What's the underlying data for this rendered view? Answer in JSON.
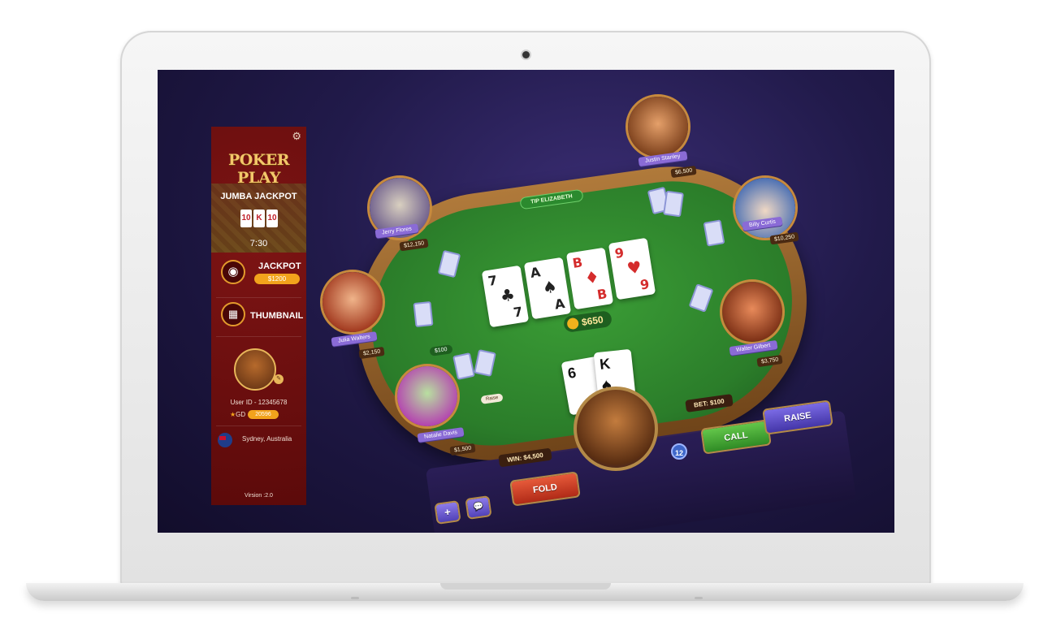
{
  "sidebar": {
    "logo": "POKER PLAY",
    "jumba_title": "JUMBA JACKPOT",
    "jumba_cards": [
      "10",
      "K",
      "10"
    ],
    "jumba_time": "7:30",
    "jackpot_label": "JACKPOT",
    "jackpot_value": "$1200",
    "thumbnail_label": "THUMBNAIL",
    "user_id": "User ID - 12345678",
    "gd_label": "GD",
    "gd_value": "20596",
    "location": "Sydney, Australia",
    "version": "Virsion :2.0"
  },
  "table": {
    "dealer_tag": "TIP ELIZABETH",
    "community_cards": [
      {
        "rank": "7",
        "suit": "♣",
        "color": "black"
      },
      {
        "rank": "A",
        "suit": "♠",
        "color": "black"
      },
      {
        "rank": "B",
        "suit": "♦",
        "color": "red"
      },
      {
        "rank": "9",
        "suit": "♥",
        "color": "red"
      }
    ],
    "pot": "$650",
    "bet_chip": "$100",
    "hole_cards": [
      "6",
      "K"
    ]
  },
  "players": {
    "jerry": {
      "name": "Jerry Flores",
      "stack": "$12,150"
    },
    "justin": {
      "name": "Justin Stanley",
      "stack": "$6,500"
    },
    "billy": {
      "name": "Billy Curtis",
      "stack": "$10,250"
    },
    "julia": {
      "name": "Julia Walters",
      "stack": "$2,150"
    },
    "walter": {
      "name": "Walter Gilbert",
      "stack": "$3,750"
    },
    "natalie": {
      "name": "Natalie Davis",
      "stack": "$1,500",
      "action": "Raise"
    }
  },
  "hud": {
    "win": "WIN: $4,500",
    "bet": "BET: $100",
    "call": "CALL",
    "raise": "RAISE",
    "fold": "FOLD",
    "plus": "+",
    "chat": "💬",
    "level": "12"
  },
  "colors": {
    "sidebar_bg": "#6d0e0e",
    "accent_gold": "#f2a31c",
    "felt": "#2b7d2a",
    "call": "#3fa52f",
    "raise": "#5a4bc8",
    "fold": "#d03f24"
  }
}
